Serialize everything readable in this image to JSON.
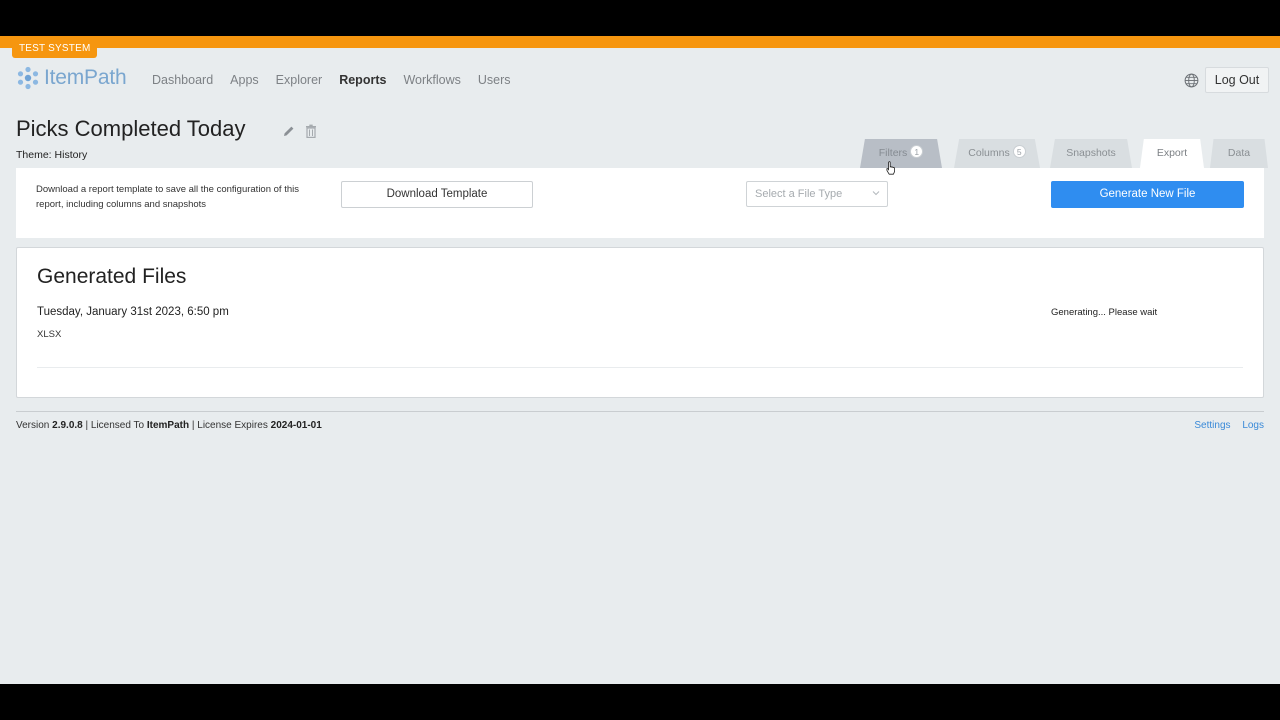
{
  "env_badge": "TEST SYSTEM",
  "app": {
    "name": "ItemPath",
    "brand_color": "#7aa6cf",
    "env_color": "#f6960f"
  },
  "nav": {
    "items": [
      {
        "label": "Dashboard",
        "active": false
      },
      {
        "label": "Apps",
        "active": false
      },
      {
        "label": "Explorer",
        "active": false
      },
      {
        "label": "Reports",
        "active": true
      },
      {
        "label": "Workflows",
        "active": false
      },
      {
        "label": "Users",
        "active": false
      }
    ],
    "logout_label": "Log Out"
  },
  "report": {
    "title": "Picks Completed Today",
    "theme_label": "Theme:",
    "theme_value": "History"
  },
  "tabs": [
    {
      "label": "Filters",
      "count": "1",
      "state": "hover"
    },
    {
      "label": "Columns",
      "count": "5",
      "state": "inactive"
    },
    {
      "label": "Snapshots",
      "count": null,
      "state": "inactive"
    },
    {
      "label": "Export",
      "count": null,
      "state": "active"
    },
    {
      "label": "Data",
      "count": null,
      "state": "inactive"
    }
  ],
  "export": {
    "description": "Download a report template to save all the configuration of this report, including columns and snapshots",
    "download_label": "Download Template",
    "file_type_placeholder": "Select a File Type",
    "generate_label": "Generate New File",
    "generate_color": "#2f8df0"
  },
  "generated_files": {
    "title": "Generated Files",
    "files": [
      {
        "date": "Tuesday, January 31st 2023, 6:50 pm",
        "type": "XLSX",
        "status": "Generating... Please wait"
      }
    ]
  },
  "footer": {
    "version_label": "Version",
    "version": "2.9.0.8",
    "licensed_label": "| Licensed To",
    "licensee": "ItemPath",
    "expires_label": "| License Expires",
    "expires": "2024-01-01",
    "links": [
      "Settings",
      "Logs"
    ],
    "link_color": "#3a8ad8"
  },
  "icons": [
    "logo-icon",
    "globe-icon",
    "edit-icon",
    "trash-icon",
    "chevron-down-icon",
    "pointer-cursor-icon"
  ]
}
